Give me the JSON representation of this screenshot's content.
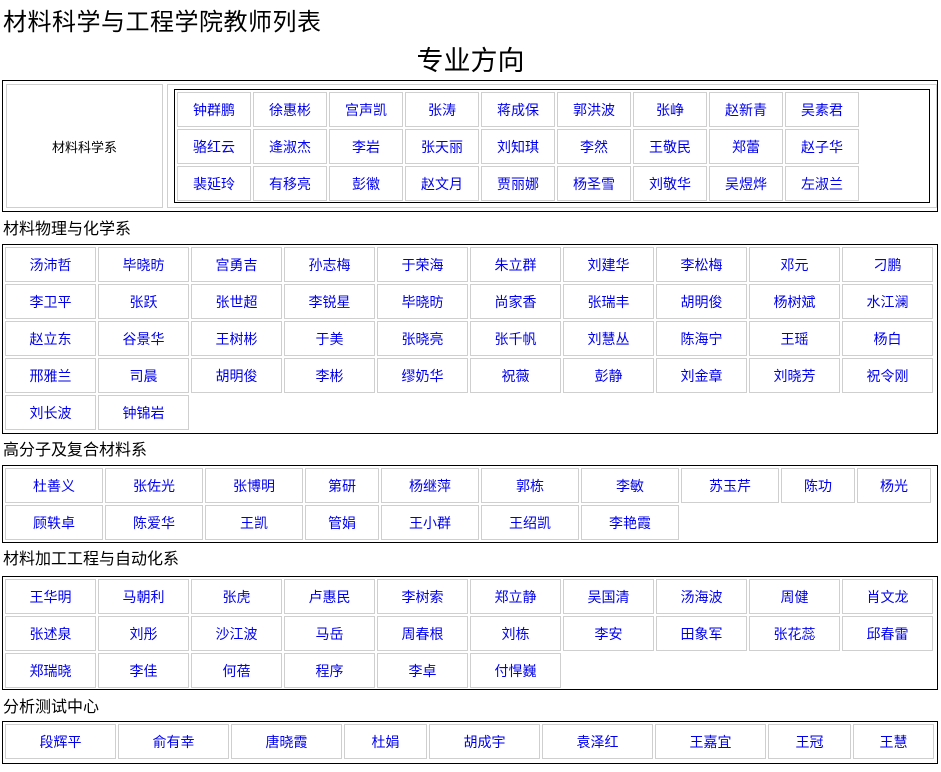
{
  "page": {
    "title": "材料科学与工程学院教师列表",
    "major_title": "专业方向"
  },
  "sections": {
    "materials_science": {
      "label": "材料科学系",
      "teachers": [
        "钟群鹏",
        "徐惠彬",
        "宫声凯",
        "张涛",
        "蒋成保",
        "郭洪波",
        "张峥",
        "赵新青",
        "吴素君",
        "骆红云",
        "逄淑杰",
        "李岩",
        "张天丽",
        "刘知琪",
        "李然",
        "王敬民",
        "郑蕾",
        "赵子华",
        "裴延玲",
        "有移亮",
        "彭徽",
        "赵文月",
        "贾丽娜",
        "杨圣雪",
        "刘敬华",
        "吴煜烨",
        "左淑兰"
      ]
    },
    "physics_chemistry": {
      "label": "材料物理与化学系",
      "teachers": [
        "汤沛哲",
        "毕晓昉",
        "宫勇吉",
        "孙志梅",
        "于荣海",
        "朱立群",
        "刘建华",
        "李松梅",
        "邓元",
        "刁鹏",
        "李卫平",
        "张跃",
        "张世超",
        "李锐星",
        "毕晓昉",
        "尚家香",
        "张瑞丰",
        "胡明俊",
        "杨树斌",
        "水江澜",
        "赵立东",
        "谷景华",
        "王树彬",
        "于美",
        "张晓亮",
        "张千帆",
        "刘慧丛",
        "陈海宁",
        "王瑶",
        "杨白",
        "邢雅兰",
        "司晨",
        "胡明俊",
        "李彬",
        "缪奶华",
        "祝薇",
        "彭静",
        "刘金章",
        "刘晓芳",
        "祝令刚",
        "刘长波",
        "钟锦岩"
      ]
    },
    "polymer_composite": {
      "label": "高分子及复合材料系",
      "teachers": [
        "杜善义",
        "张佐光",
        "张博明",
        "第研",
        "杨继萍",
        "郭栋",
        "李敏",
        "苏玉芹",
        "陈功",
        "杨光",
        "顾轶卓",
        "陈爱华",
        "王凯",
        "管娟",
        "王小群",
        "王绍凯",
        "李艳霞"
      ]
    },
    "processing_automation": {
      "label": "材料加工工程与自动化系",
      "teachers": [
        "王华明",
        "马朝利",
        "张虎",
        "卢惠民",
        "李树索",
        "郑立静",
        "吴国清",
        "汤海波",
        "周健",
        "肖文龙",
        "张述泉",
        "刘彤",
        "沙江波",
        "马岳",
        "周春根",
        "刘栋",
        "李安",
        "田象军",
        "张花蕊",
        "邱春雷",
        "郑瑞晓",
        "李佳",
        "何蓓",
        "程序",
        "李卓",
        "付悍巍"
      ]
    },
    "analysis_center": {
      "label": "分析测试中心",
      "teachers": [
        "段辉平",
        "俞有幸",
        "唐晓霞",
        "杜娟",
        "胡成宇",
        "袁泽红",
        "王嘉宜",
        "王冠",
        "王慧"
      ]
    }
  },
  "colors": {
    "link": "#0000ee",
    "border": "#000000",
    "cell_border": "#cfcfcf"
  }
}
